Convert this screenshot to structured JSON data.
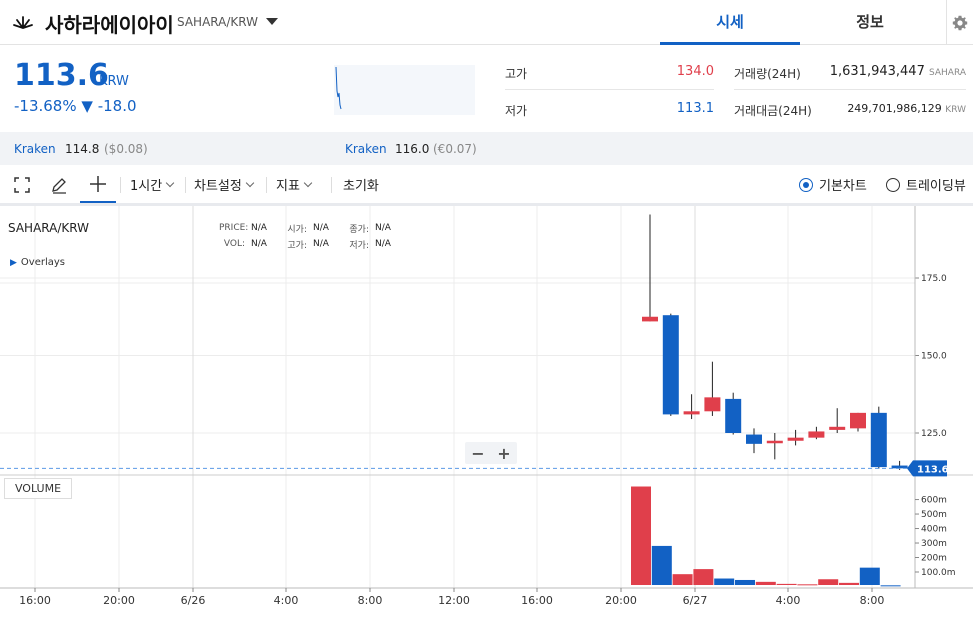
{
  "header": {
    "coin_name": "사하라에이아이",
    "pair": "SAHARA/KRW",
    "tabs": [
      {
        "label": "시세",
        "active": true
      },
      {
        "label": "정보",
        "active": false
      }
    ]
  },
  "price": {
    "current": "113.6",
    "unit": "KRW",
    "change_pct": "-13.68%",
    "change_abs": "▼ -18.0",
    "color": "#1261c4"
  },
  "stats": {
    "high_label": "고가",
    "high_value": "134.0",
    "low_label": "저가",
    "low_value": "113.1",
    "volume_label": "거래량(24H)",
    "volume_value": "1,631,943,447",
    "volume_unit": "SAHARA",
    "turnover_label": "거래대금(24H)",
    "turnover_value": "249,701,986,129",
    "turnover_unit": "KRW"
  },
  "exchanges": [
    {
      "name": "Kraken",
      "price": "114.8",
      "sub": "($0.08)"
    },
    {
      "name": "Kraken",
      "price": "116.0",
      "sub": "(€0.07)"
    }
  ],
  "toolbar": {
    "interval": "1시간",
    "chart_settings": "차트설정",
    "indicators": "지표",
    "reset": "초기화",
    "view_basic": "기본차트",
    "view_tradingview": "트레이딩뷰"
  },
  "chart": {
    "pair": "SAHARA/KRW",
    "overlays": "Overlays",
    "legend": {
      "price_key": "PRICE:",
      "price_val": "N/A",
      "open_key": "시가:",
      "open_val": "N/A",
      "close_key": "종가:",
      "close_val": "N/A",
      "vol_key": "VOL:",
      "vol_val": "N/A",
      "high_key": "고가:",
      "high_val": "N/A",
      "low_key": "저가:",
      "low_val": "N/A"
    },
    "zoom_out": "−",
    "zoom_in": "+",
    "volume_label": "VOLUME",
    "last_price_tag": "113.6"
  },
  "chart_data": {
    "type": "candlestick",
    "x_ticks": [
      "16:00",
      "20:00",
      "6/26",
      "4:00",
      "8:00",
      "12:00",
      "16:00",
      "20:00",
      "6/27",
      "4:00",
      "8:00"
    ],
    "y_ticks": [
      125.0,
      150.0,
      175.0
    ],
    "y_tick_labels": [
      "125.0",
      "150.0",
      "175.0"
    ],
    "volume_ticks": [
      "100.0m",
      "200m",
      "300m",
      "400m",
      "500m",
      "600m"
    ],
    "last_price": 113.6,
    "candles": [
      {
        "t": "6/26 21:00",
        "open": 161.0,
        "close": 162.5,
        "high": 195.5,
        "low": 161.0,
        "volume": 690
      },
      {
        "t": "6/26 22:00",
        "open": 163.0,
        "close": 131.0,
        "high": 163.5,
        "low": 130.5,
        "volume": 280
      },
      {
        "t": "6/26 23:00",
        "open": 131.0,
        "close": 132.0,
        "high": 137.5,
        "low": 129.5,
        "volume": 85
      },
      {
        "t": "6/27 00:00",
        "open": 132.0,
        "close": 136.5,
        "high": 148.0,
        "low": 130.5,
        "volume": 120
      },
      {
        "t": "6/27 01:00",
        "open": 136.0,
        "close": 125.0,
        "high": 138.0,
        "low": 124.5,
        "volume": 55
      },
      {
        "t": "6/27 02:00",
        "open": 124.5,
        "close": 121.5,
        "high": 126.5,
        "low": 118.5,
        "volume": 45
      },
      {
        "t": "6/27 03:00",
        "open": 122.0,
        "close": 122.5,
        "high": 125.0,
        "low": 116.5,
        "volume": 32
      },
      {
        "t": "6/27 04:00",
        "open": 122.5,
        "close": 123.5,
        "high": 126.0,
        "low": 121.0,
        "volume": 18
      },
      {
        "t": "6/27 05:00",
        "open": 123.5,
        "close": 125.5,
        "high": 127.0,
        "low": 123.0,
        "volume": 15
      },
      {
        "t": "6/27 06:00",
        "open": 126.0,
        "close": 127.0,
        "high": 133.0,
        "low": 125.0,
        "volume": 50
      },
      {
        "t": "6/27 07:00",
        "open": 126.5,
        "close": 131.5,
        "high": 131.5,
        "low": 125.5,
        "volume": 25
      },
      {
        "t": "6/27 08:00",
        "open": 131.5,
        "close": 114.0,
        "high": 133.5,
        "low": 113.5,
        "volume": 130
      },
      {
        "t": "6/27 09:00",
        "open": 114.5,
        "close": 113.6,
        "high": 116.0,
        "low": 113.1,
        "volume": 8
      }
    ],
    "colors": {
      "up": "#e03f4b",
      "down": "#1261c4"
    }
  }
}
